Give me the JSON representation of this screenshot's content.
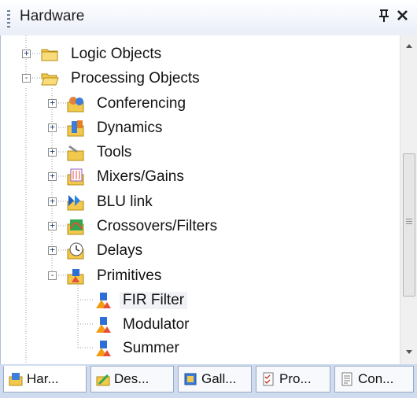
{
  "panel": {
    "title": "Hardware",
    "pin_glyph": "Ͱ",
    "close_glyph": "×"
  },
  "tree": {
    "items": [
      {
        "label": "Logic Objects",
        "icon": "folder-icon",
        "expander": "+"
      },
      {
        "label": "Processing Objects",
        "icon": "folder-open-icon",
        "expander": "-"
      },
      {
        "label": "Conferencing",
        "icon": "conferencing-icon",
        "expander": "+"
      },
      {
        "label": "Dynamics",
        "icon": "dynamics-icon",
        "expander": "+"
      },
      {
        "label": "Tools",
        "icon": "tools-icon",
        "expander": "+"
      },
      {
        "label": "Mixers/Gains",
        "icon": "mixers-icon",
        "expander": "+"
      },
      {
        "label": "BLU link",
        "icon": "blu-link-icon",
        "expander": "+"
      },
      {
        "label": "Crossovers/Filters",
        "icon": "crossovers-icon",
        "expander": "+"
      },
      {
        "label": "Delays",
        "icon": "delays-icon",
        "expander": "+"
      },
      {
        "label": "Primitives",
        "icon": "primitives-icon",
        "expander": "-"
      },
      {
        "label": "FIR Filter",
        "icon": "fir-filter-icon",
        "selected": true
      },
      {
        "label": "Modulator",
        "icon": "modulator-icon"
      },
      {
        "label": "Summer",
        "icon": "summer-icon"
      }
    ]
  },
  "tabs": [
    {
      "label": "Har...",
      "icon": "hardware-tab-icon",
      "active": true
    },
    {
      "label": "Des...",
      "icon": "design-tab-icon"
    },
    {
      "label": "Gall...",
      "icon": "gallery-tab-icon"
    },
    {
      "label": "Pro...",
      "icon": "properties-tab-icon"
    },
    {
      "label": "Con...",
      "icon": "console-tab-icon"
    }
  ]
}
